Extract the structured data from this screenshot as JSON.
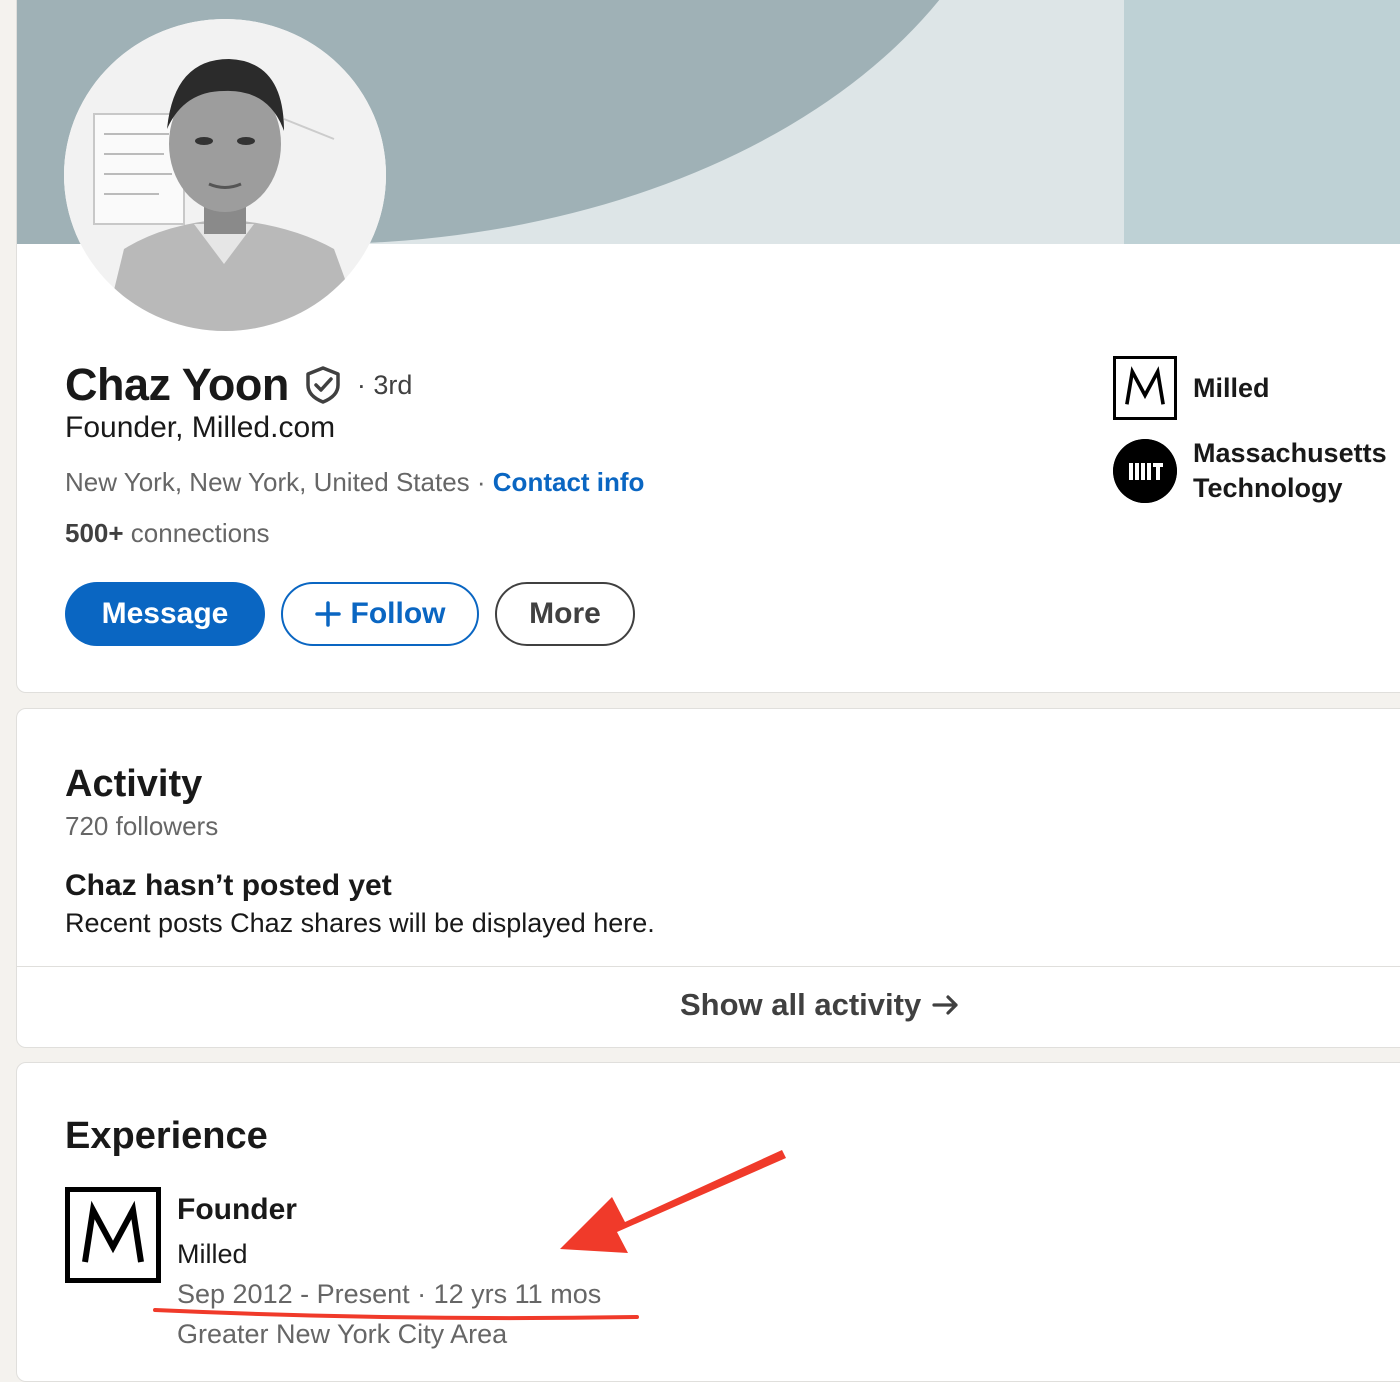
{
  "profile": {
    "name": "Chaz Yoon",
    "degree": "· 3rd",
    "headline": "Founder, Milled.com",
    "location": "New York, New York, United States",
    "separator": " · ",
    "contact_link": "Contact info",
    "connections_count": "500+",
    "connections_label": " connections",
    "buttons": {
      "message": "Message",
      "follow": "Follow",
      "more": "More"
    }
  },
  "side_panel": {
    "company": "Milled",
    "school_line1": "Massachusetts",
    "school_line2": "Technology"
  },
  "activity": {
    "title": "Activity",
    "followers": "720 followers",
    "empty_title": "Chaz hasn’t posted yet",
    "empty_desc": "Recent posts Chaz shares will be displayed here.",
    "show_all": "Show all activity"
  },
  "experience": {
    "title": "Experience",
    "items": [
      {
        "role": "Founder",
        "company": "Milled",
        "dates": "Sep 2012 - Present · 12 yrs 11 mos",
        "location": "Greater New York City Area"
      }
    ]
  },
  "icons": {
    "verify": "shield-check-icon",
    "follow_plus": "plus-icon",
    "show_all_arrow": "arrow-right-icon"
  },
  "colors": {
    "brand_blue": "#0a66c2",
    "annotation_red": "#f03a2a"
  }
}
